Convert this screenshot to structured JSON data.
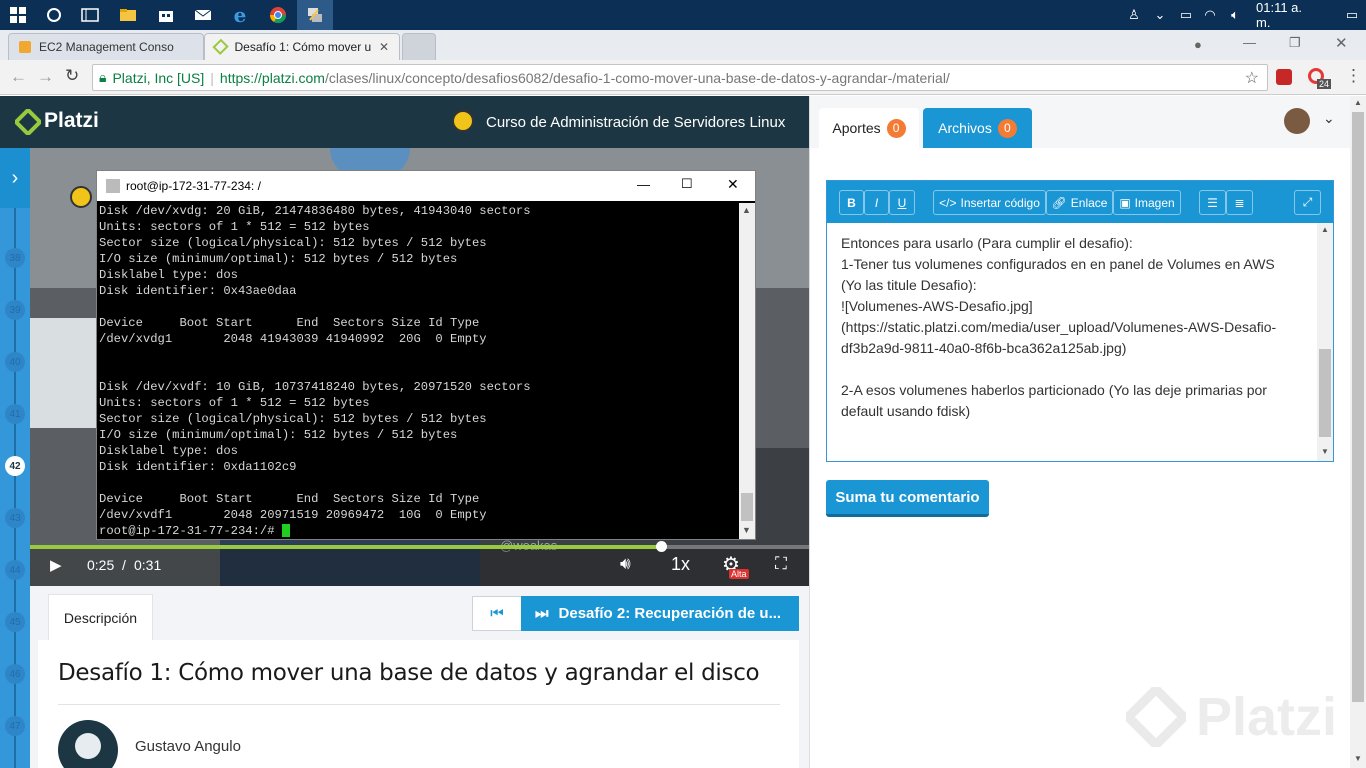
{
  "taskbar": {
    "time": "01:11 a. m."
  },
  "browser": {
    "tabs": [
      {
        "label": "EC2 Management Conso"
      },
      {
        "label": "Desafío 1: Cómo mover u"
      }
    ],
    "secure_label": "Platzi, Inc [US]",
    "url_host": "https://platzi.com",
    "url_path": "/clases/linux/concepto/desafios6082/desafio-1-como-mover-una-base-de-datos-y-agrandar-/material/",
    "ext_badge": "24"
  },
  "platzi": {
    "logo": "Platzi",
    "course_title": "Curso de Administración de Servidores Linux",
    "class_numbers": [
      "38",
      "39",
      "40",
      "41",
      "42",
      "43",
      "44",
      "45",
      "46",
      "47"
    ],
    "current_class": "42"
  },
  "terminal": {
    "title": "root@ip-172-31-77-234: /",
    "lines": [
      "Disk /dev/xvdg: 20 GiB, 21474836480 bytes, 41943040 sectors",
      "Units: sectors of 1 * 512 = 512 bytes",
      "Sector size (logical/physical): 512 bytes / 512 bytes",
      "I/O size (minimum/optimal): 512 bytes / 512 bytes",
      "Disklabel type: dos",
      "Disk identifier: 0x43ae0daa",
      "",
      "Device     Boot Start      End  Sectors Size Id Type",
      "/dev/xvdg1       2048 41943039 41940992  20G  0 Empty",
      "",
      "",
      "Disk /dev/xvdf: 10 GiB, 10737418240 bytes, 20971520 sectors",
      "Units: sectors of 1 * 512 = 512 bytes",
      "Sector size (logical/physical): 512 bytes / 512 bytes",
      "I/O size (minimum/optimal): 512 bytes / 512 bytes",
      "Disklabel type: dos",
      "Disk identifier: 0xda1102c9",
      "",
      "Device     Boot Start      End  Sectors Size Id Type",
      "/dev/xvdf1       2048 20971519 20969472  10G  0 Empty"
    ],
    "prompt": "root@ip-172-31-77-234:/# "
  },
  "player": {
    "current_time": "0:25",
    "separator": "/",
    "duration": "0:31",
    "speed": "1x",
    "quality_badge": "Alta",
    "progress_fraction": 0.81,
    "watermark": "@woakas"
  },
  "below_video": {
    "tab_description": "Descripción",
    "next_label": "Desafío 2: Recuperación de u...",
    "class_title": "Desafío 1: Cómo mover una base de datos y agrandar el disco",
    "author": "Gustavo Angulo"
  },
  "right": {
    "tab_aportes": "Aportes",
    "aportes_count": "0",
    "tab_archivos": "Archivos",
    "archivos_count": "0",
    "toolbar": {
      "bold": "B",
      "italic": "I",
      "underline": "U",
      "code": "Insertar código",
      "link": "Enlace",
      "image": "Imagen"
    },
    "editor_lines": [
      "Entonces para usarlo (Para cumplir el desafio):",
      "1-Tener tus volumenes configurados en en panel de Volumes en AWS",
      "(Yo las titule Desafio):",
      "![Volumenes-AWS-Desafio.jpg]",
      "(https://static.platzi.com/media/user_upload/Volumenes-AWS-Desafio-",
      "df3b2a9d-9811-40a0-8f6b-bca362a125ab.jpg)",
      "",
      "2-A esos volumenes haberlos particionado (Yo las deje primarias por",
      "default usando fdisk)"
    ],
    "submit": "Suma tu comentario",
    "watermark": "Platzi"
  },
  "colors": {
    "platzi_dark": "#1c3643",
    "platzi_blue": "#1a96d4",
    "badge_orange": "#f47b34",
    "progress_green": "#98ca3f"
  }
}
